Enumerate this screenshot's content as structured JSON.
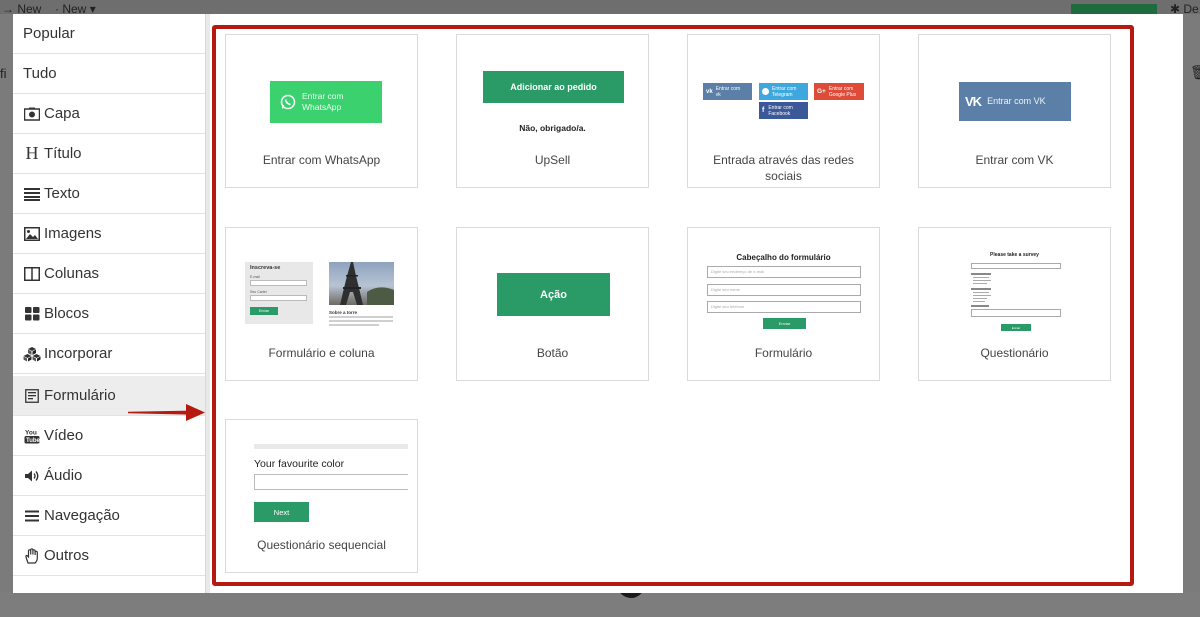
{
  "background": {
    "top_left_text_1": "New",
    "top_left_text_2": "New",
    "top_right_text": "De",
    "left_fragment": "fi",
    "right_fragment": "🗑"
  },
  "sidebar": {
    "items": [
      {
        "label": "Popular",
        "icon": "none"
      },
      {
        "label": "Tudo",
        "icon": "none"
      },
      {
        "label": "Capa",
        "icon": "camera-icon"
      },
      {
        "label": "Título",
        "icon": "heading-icon"
      },
      {
        "label": "Texto",
        "icon": "text-lines-icon"
      },
      {
        "label": "Imagens",
        "icon": "image-icon"
      },
      {
        "label": "Colunas",
        "icon": "columns-icon"
      },
      {
        "label": "Blocos",
        "icon": "blocks-icon"
      },
      {
        "label": "Incorporar",
        "icon": "cubes-icon"
      },
      {
        "label": "Formulário",
        "icon": "form-icon",
        "active": true
      },
      {
        "label": "Vídeo",
        "icon": "youtube-icon"
      },
      {
        "label": "Áudio",
        "icon": "speaker-icon"
      },
      {
        "label": "Navegação",
        "icon": "menu-icon"
      },
      {
        "label": "Outros",
        "icon": "hand-icon"
      }
    ]
  },
  "cards": {
    "whatsapp": {
      "label": "Entrar com WhatsApp",
      "btn": "Entrar com WhatsApp"
    },
    "upsell": {
      "label": "UpSell",
      "btn": "Adicionar ao pedido",
      "link": "Não, obrigado/a."
    },
    "social": {
      "label": "Entrada através das redes sociais",
      "vk": "Entrar com vk",
      "telegram": "Entrar com Telegram",
      "google": "Entrar com Google Plus",
      "facebook": "Entrar com Facebook"
    },
    "vk": {
      "label": "Entrar com VK",
      "btn": "Entrar com VK"
    },
    "form_column": {
      "label": "Formulário e coluna",
      "title": "Inscreva-se",
      "field1": "E-mail",
      "field2": "Seu Cartel",
      "btn": "Enviar",
      "about": "Sobre a torre"
    },
    "button": {
      "label": "Botão",
      "btn": "Ação"
    },
    "form": {
      "label": "Formulário",
      "title": "Cabeçalho do formulário",
      "ph1": "Digite seu endereço de e-mail",
      "ph2": "Digite seu nome",
      "ph3": "Digite seu telefone",
      "btn": "Enviar"
    },
    "survey": {
      "label": "Questionário",
      "title": "Please take a survey",
      "btn": "Enviar"
    },
    "sequential": {
      "label": "Questionário sequencial",
      "question": "Your favourite color",
      "btn": "Next"
    }
  },
  "colors": {
    "green": "#2a9a66",
    "whatsapp": "#3bd16f",
    "vk": "#5b7fa6",
    "telegram": "#3ea8de",
    "google": "#de4b39",
    "facebook": "#3b5898",
    "frame": "#b5190f"
  }
}
